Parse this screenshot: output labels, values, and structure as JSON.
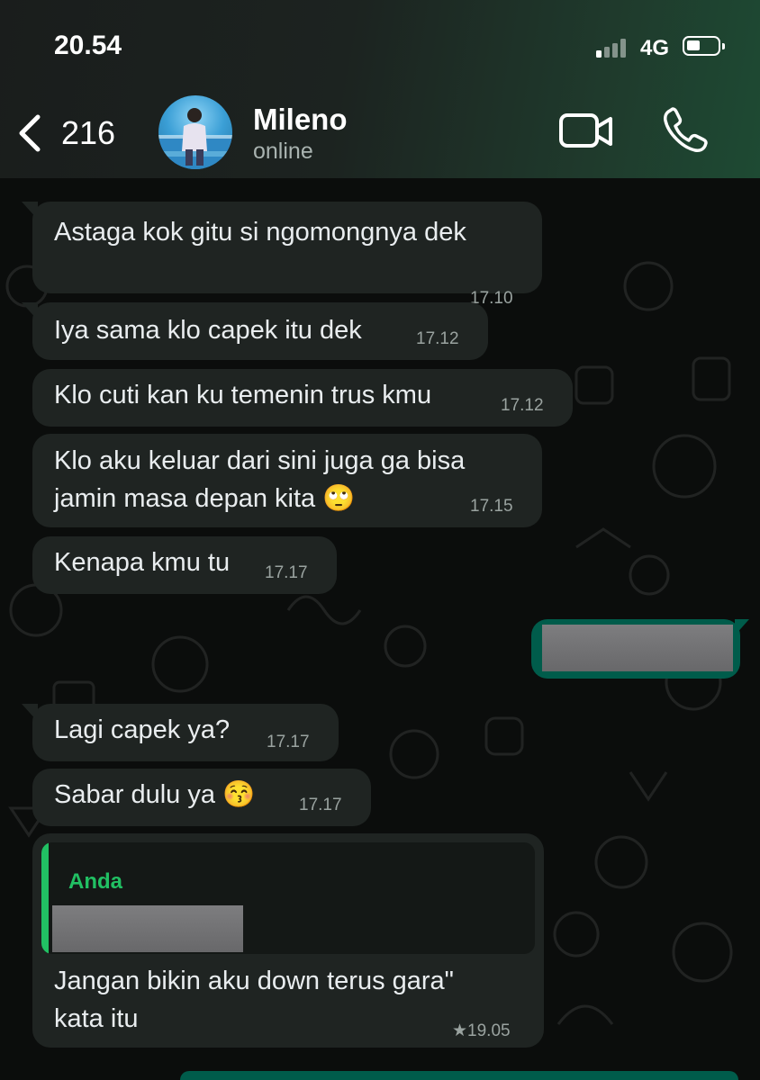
{
  "status_bar": {
    "time": "20.54",
    "network": "4G"
  },
  "header": {
    "back_count": "216",
    "contact_name": "Mileno",
    "contact_status": "online",
    "icons": {
      "back": "chevron-left-icon",
      "video": "video-camera-icon",
      "call": "phone-icon"
    }
  },
  "messages": [
    {
      "text": "Astaga kok gitu si ngomongnya dek",
      "time": "17.10"
    },
    {
      "text": "Iya sama klo capek itu dek",
      "time": "17.12"
    },
    {
      "text": "Klo cuti kan ku temenin trus kmu",
      "time": "17.12"
    },
    {
      "text_line1": "Klo aku keluar dari sini juga ga bisa",
      "text_line2": "jamin masa depan kita 🙄",
      "time": "17.15"
    },
    {
      "text": "Kenapa kmu tu",
      "time": "17.17"
    },
    {
      "text": "Lagi capek ya?",
      "time": "17.17"
    },
    {
      "text": "Sabar dulu ya 😚",
      "time": "17.17"
    },
    {
      "quote_author": "Anda",
      "text_line1": "Jangan bikin aku down terus gara\"",
      "text_line2": "kata itu",
      "time": "★19.05"
    }
  ],
  "colors": {
    "incoming_bubble": "#1f2422",
    "outgoing_bubble": "#005c4b",
    "accent_green": "#21c063",
    "chat_background": "#0b0d0c"
  }
}
